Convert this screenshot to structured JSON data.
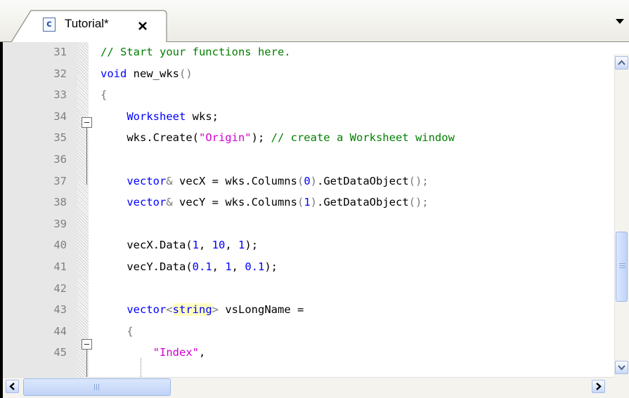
{
  "tab": {
    "label": "Tutorial*",
    "icon_letter": "c",
    "icon": "c-source-file-icon",
    "close_icon": "close-icon",
    "menu_icon": "dropdown-arrow-icon"
  },
  "colors": {
    "keyword": "#0000ff",
    "comment": "#008000",
    "string": "#d000d0",
    "number": "#0000ff",
    "line_number": "#7f7f7f",
    "gutter": "#e7e7e7",
    "highlight": "#ffffc2",
    "scrollbar_thumb": "#c1d4f7"
  },
  "editor": {
    "lines": [
      {
        "num": "31",
        "tokens": [
          {
            "t": "// Start your functions here.",
            "c": "cm"
          }
        ]
      },
      {
        "num": "32",
        "tokens": [
          {
            "t": "void",
            "c": "kw"
          },
          {
            "t": " new_wks"
          },
          {
            "t": "()",
            "c": "pn"
          }
        ]
      },
      {
        "num": "33",
        "tokens": [
          {
            "t": "{",
            "c": "pn"
          }
        ]
      },
      {
        "num": "34",
        "tokens": [
          {
            "t": "    "
          },
          {
            "t": "Worksheet",
            "c": "kw"
          },
          {
            "t": " wks;"
          }
        ]
      },
      {
        "num": "35",
        "tokens": [
          {
            "t": "    wks.Create("
          },
          {
            "t": "\"Origin\"",
            "c": "st"
          },
          {
            "t": "); "
          },
          {
            "t": "// create a Worksheet window",
            "c": "cm"
          }
        ]
      },
      {
        "num": "36",
        "tokens": []
      },
      {
        "num": "37",
        "tokens": [
          {
            "t": "    "
          },
          {
            "t": "vector",
            "c": "kw"
          },
          {
            "t": "&",
            "c": "pn"
          },
          {
            "t": " vecX = wks.Columns"
          },
          {
            "t": "(",
            "c": "pn"
          },
          {
            "t": "0",
            "c": "nm"
          },
          {
            "t": ")",
            "c": "pn"
          },
          {
            "t": ".GetDataObject"
          },
          {
            "t": "();",
            "c": "pn"
          }
        ]
      },
      {
        "num": "38",
        "tokens": [
          {
            "t": "    "
          },
          {
            "t": "vector",
            "c": "kw"
          },
          {
            "t": "&",
            "c": "pn"
          },
          {
            "t": " vecY = wks.Columns"
          },
          {
            "t": "(",
            "c": "pn"
          },
          {
            "t": "1",
            "c": "nm"
          },
          {
            "t": ")",
            "c": "pn"
          },
          {
            "t": ".GetDataObject"
          },
          {
            "t": "();",
            "c": "pn"
          }
        ]
      },
      {
        "num": "39",
        "tokens": []
      },
      {
        "num": "40",
        "tokens": [
          {
            "t": "    vecX.Data("
          },
          {
            "t": "1",
            "c": "nm"
          },
          {
            "t": ", "
          },
          {
            "t": "10",
            "c": "nm"
          },
          {
            "t": ", "
          },
          {
            "t": "1",
            "c": "nm"
          },
          {
            "t": ");"
          }
        ]
      },
      {
        "num": "41",
        "tokens": [
          {
            "t": "    vecY.Data("
          },
          {
            "t": "0.1",
            "c": "nm"
          },
          {
            "t": ", "
          },
          {
            "t": "1",
            "c": "nm"
          },
          {
            "t": ", "
          },
          {
            "t": "0.1",
            "c": "nm"
          },
          {
            "t": ");"
          }
        ]
      },
      {
        "num": "42",
        "tokens": []
      },
      {
        "num": "43",
        "tokens": [
          {
            "t": "    "
          },
          {
            "t": "vector",
            "c": "kw"
          },
          {
            "t": "<",
            "c": "pn"
          },
          {
            "t": "string",
            "c": "hl"
          },
          {
            "t": ">",
            "c": "pn"
          },
          {
            "t": " vsLongName ="
          }
        ]
      },
      {
        "num": "44",
        "tokens": [
          {
            "t": "    "
          },
          {
            "t": "{",
            "c": "pn"
          }
        ]
      },
      {
        "num": "45",
        "tokens": [
          {
            "t": "        "
          },
          {
            "t": "\"Index\"",
            "c": "st"
          },
          {
            "t": ","
          }
        ]
      }
    ],
    "fold_lines": [
      "33",
      "44"
    ]
  },
  "scrollbars": {
    "vertical": {
      "up_icon": "scroll-up-arrow-icon",
      "down_icon": "scroll-down-arrow-icon"
    },
    "horizontal": {
      "left_icon": "scroll-left-arrow-icon",
      "right_icon": "scroll-right-arrow-icon"
    }
  }
}
